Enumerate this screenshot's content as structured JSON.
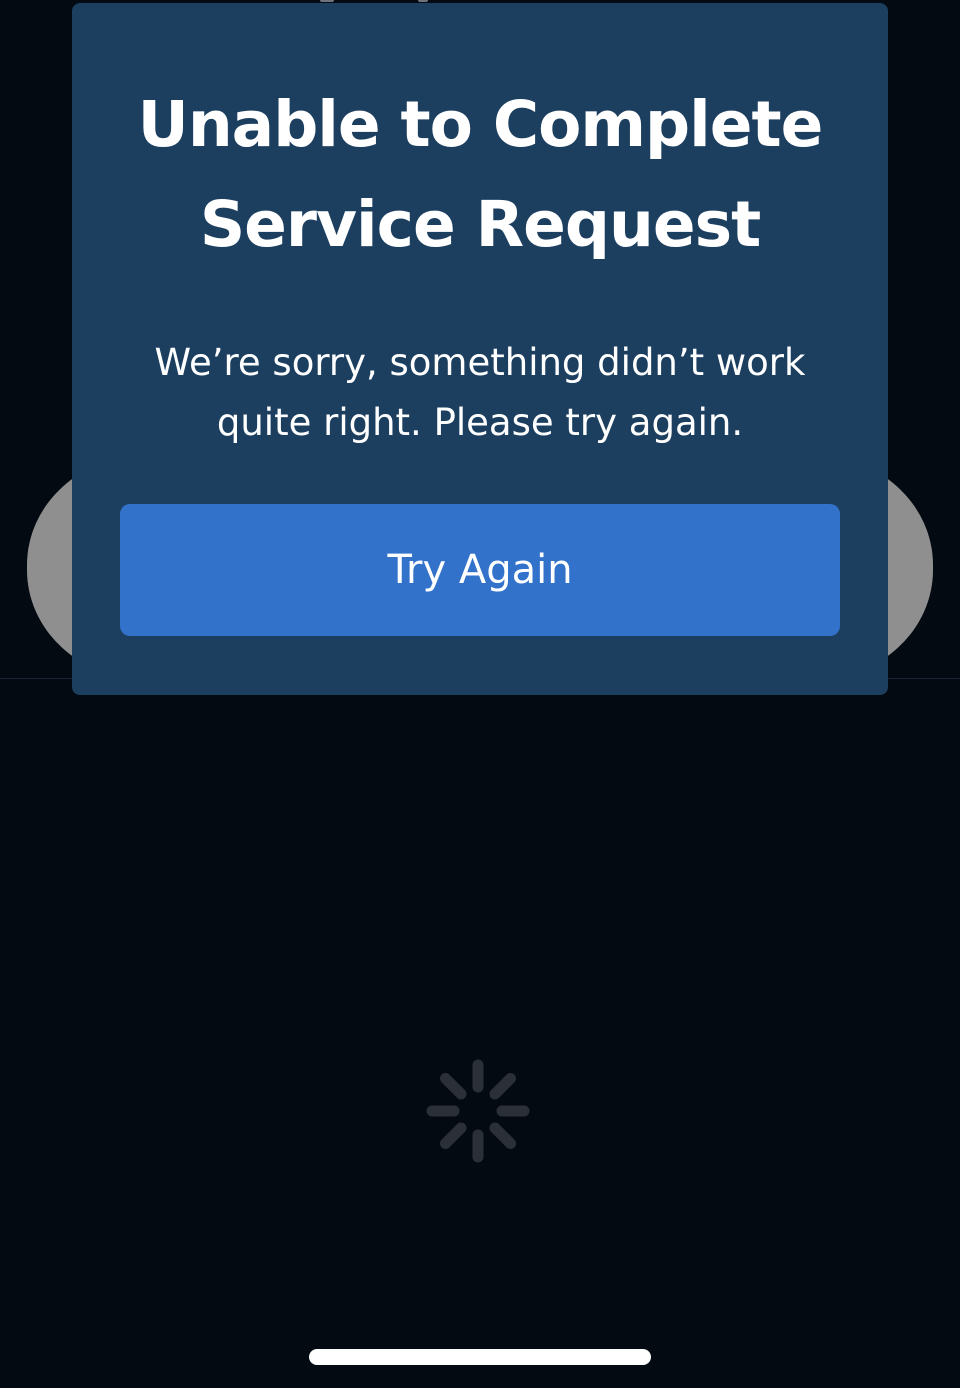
{
  "modal": {
    "title": "Unable to Complete Service Request",
    "message": "We’re sorry, something didn’t work quite right. Please try again.",
    "button_label": "Try Again"
  },
  "icons": {
    "spinner": "loading-spinner-icon"
  },
  "colors": {
    "background": "#040a12",
    "modal_background": "#1c3f60",
    "button": "#3272cb",
    "text": "#ffffff",
    "spinner": "#2b3038"
  }
}
